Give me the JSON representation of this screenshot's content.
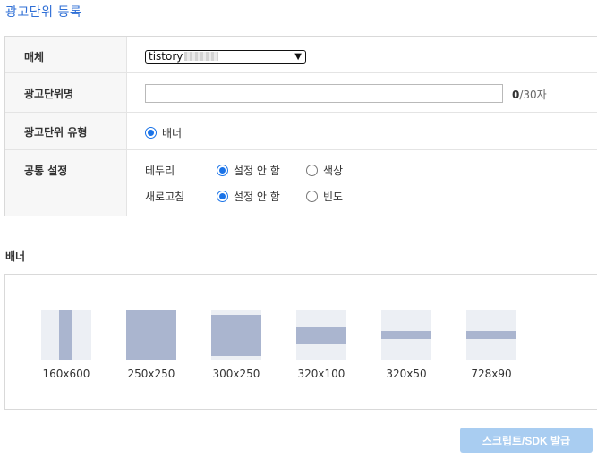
{
  "header": {
    "title": "광고단위 등록"
  },
  "form": {
    "media": {
      "label": "매체",
      "selected_value": "tistory"
    },
    "name": {
      "label": "광고단위명",
      "value": "",
      "count_current": "0",
      "count_max": "/30자"
    },
    "type": {
      "label": "광고단위 유형",
      "option": "배너"
    },
    "common": {
      "label": "공통 설정",
      "border": {
        "label": "테두리",
        "option_off": "설정 안 함",
        "option_color": "색상"
      },
      "refresh": {
        "label": "새로고침",
        "option_off": "설정 안 함",
        "option_freq": "빈도"
      }
    }
  },
  "banner_section": {
    "title": "배너",
    "sizes": [
      "160x600",
      "250x250",
      "300x250",
      "320x100",
      "320x50",
      "728x90"
    ]
  },
  "actions": {
    "issue_label": "스크립트/SDK 발급"
  }
}
